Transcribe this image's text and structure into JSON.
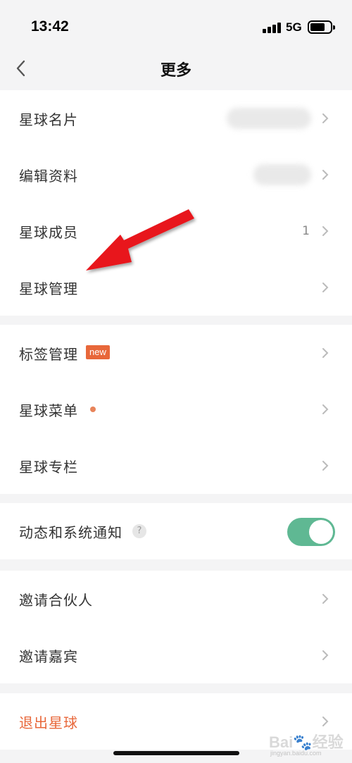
{
  "status_bar": {
    "time": "13:42",
    "network": "5G"
  },
  "nav": {
    "title": "更多"
  },
  "group1": {
    "items": [
      {
        "label": "星球名片"
      },
      {
        "label": "编辑资料"
      },
      {
        "label": "星球成员",
        "count": "1"
      },
      {
        "label": "星球管理"
      }
    ]
  },
  "group2": {
    "items": [
      {
        "label": "标签管理",
        "badge": "new"
      },
      {
        "label": "星球菜单"
      },
      {
        "label": "星球专栏"
      }
    ]
  },
  "group3": {
    "items": [
      {
        "label": "动态和系统通知",
        "help": "?",
        "toggle_on": true
      }
    ]
  },
  "group4": {
    "items": [
      {
        "label": "邀请合伙人"
      },
      {
        "label": "邀请嘉宾"
      }
    ]
  },
  "group5": {
    "items": [
      {
        "label": "退出星球"
      }
    ]
  },
  "watermark": {
    "text": "Bai🐾经验",
    "sub": "jingyan.baidu.com"
  },
  "colors": {
    "accent": "#e8673a",
    "toggle": "#5fb893",
    "arrow": "#e8161c"
  }
}
